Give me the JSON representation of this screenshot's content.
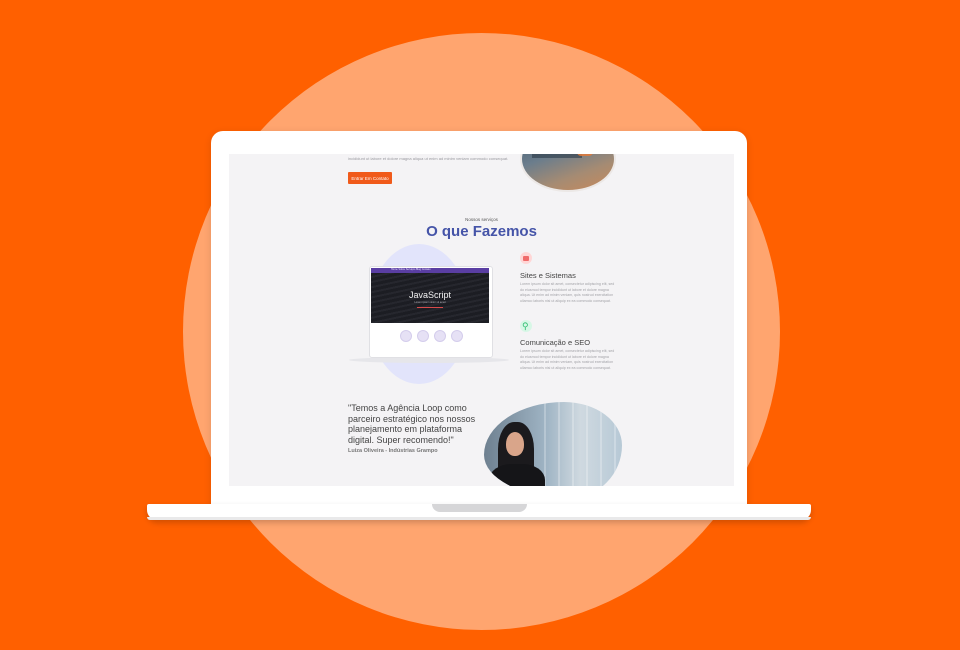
{
  "page": {
    "hero": {
      "text": "incididunt ut labore et dolore magna aliqua ut enim ad minim veniam commodo consequat.",
      "cta_label": "Entrar Em Contato"
    },
    "services": {
      "eyebrow": "Nossos serviços",
      "title": "O que Fazemos",
      "mockup": {
        "nav_text": "Home   Sobre   Serviços   Blog   Contato",
        "headline": "JavaScript",
        "sub": "Lorem ipsum dolor sit amet"
      },
      "items": [
        {
          "title": "Sites e Sistemas",
          "description": "Lorem ipsum dolor sit amet, consectetur adipiscing elit, sed do eiusmod tempor incididunt ut labore et dolore magna aliqua. Ut enim ad minim veniam, quis nostrud exercitation ullamco laboris nisi ut aliquip ex ea commodo consequat.",
          "icon": "window-icon"
        },
        {
          "title": "Comunicação e SEO",
          "description": "Lorem ipsum dolor sit amet, consectetur adipiscing elit, sed do eiusmod tempor incididunt ut labore et dolore magna aliqua. Ut enim ad minim veniam, quis nostrud exercitation ullamco laboris nisi ut aliquip ex ea commodo consequat.",
          "icon": "search-icon"
        }
      ]
    },
    "testimonial": {
      "quote": "\"Temos a Agência Loop como parceiro estratégico nos nossos planejamento em plataforma digital. Super recomendo!\"",
      "author": "Luiza Oliveira - Indústrias Grampo"
    }
  },
  "colors": {
    "background": "#ff6000",
    "circle": "#ffa56f",
    "accent": "#f05a1a",
    "title": "#4554a8"
  }
}
